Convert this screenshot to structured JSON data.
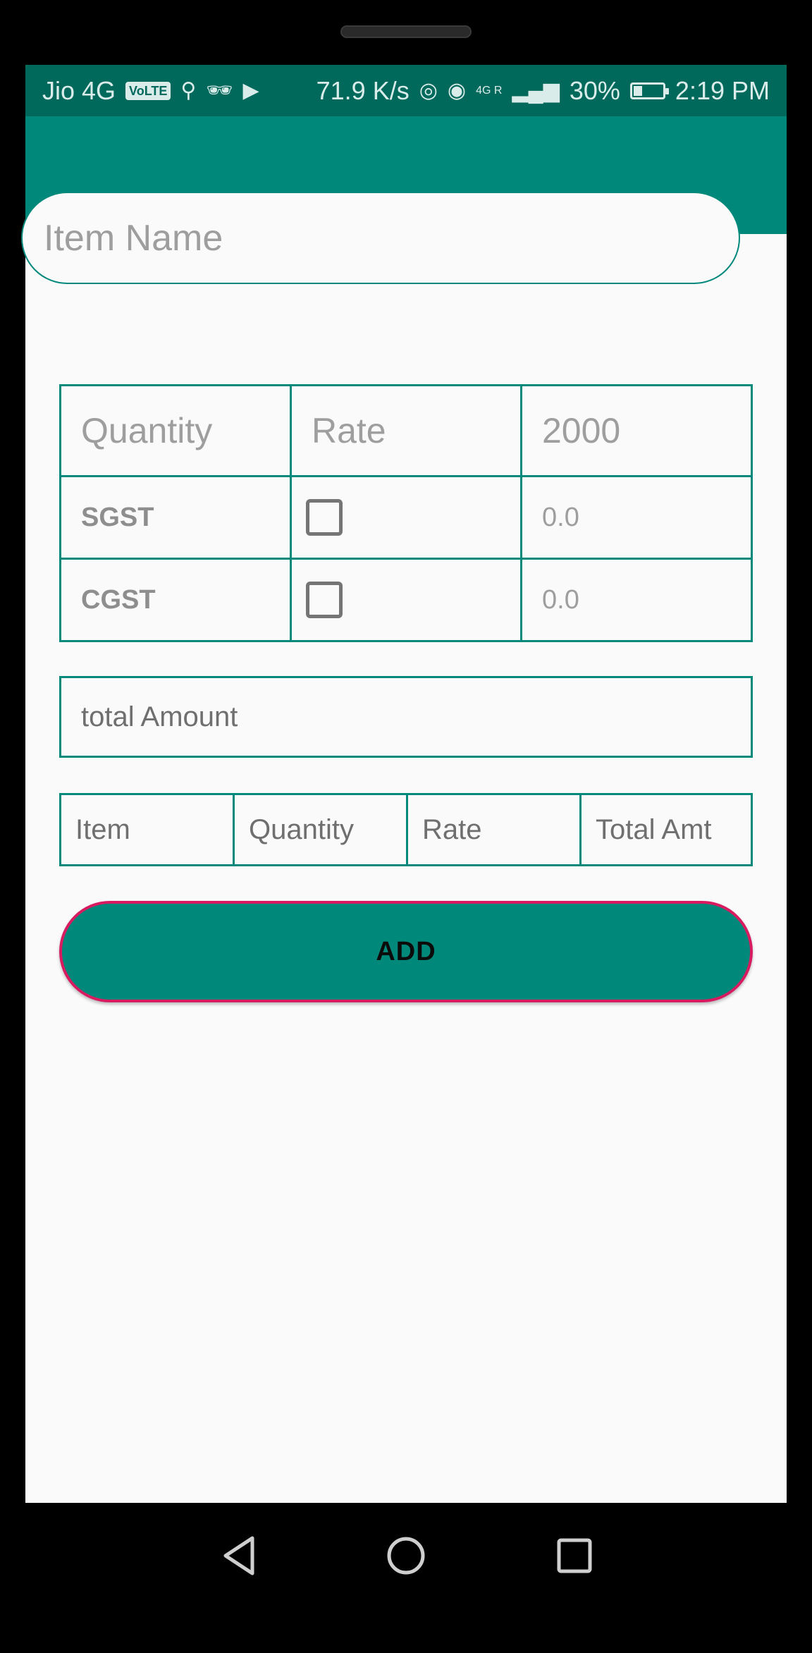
{
  "status_bar": {
    "carrier": "Jio 4G",
    "volte": "VoLTE",
    "speed": "71.9 K/s",
    "network": "4G R",
    "battery_percent": "30%",
    "battery_level": 0.3,
    "time": "2:19 PM"
  },
  "form": {
    "item_name_placeholder": "Item Name",
    "quantity_placeholder": "Quantity",
    "rate_placeholder": "Rate",
    "amount_value": "2000",
    "sgst_label": "SGST",
    "sgst_value": "0.0",
    "cgst_label": "CGST",
    "cgst_value": "0.0",
    "total_amount_placeholder": "total Amount"
  },
  "table_header": [
    "Item",
    "Quantity",
    "Rate",
    "Total Amt"
  ],
  "actions": {
    "add_label": "ADD"
  },
  "colors": {
    "primary": "#00897b",
    "primary_dark": "#00695c",
    "accent": "#d81b60"
  }
}
